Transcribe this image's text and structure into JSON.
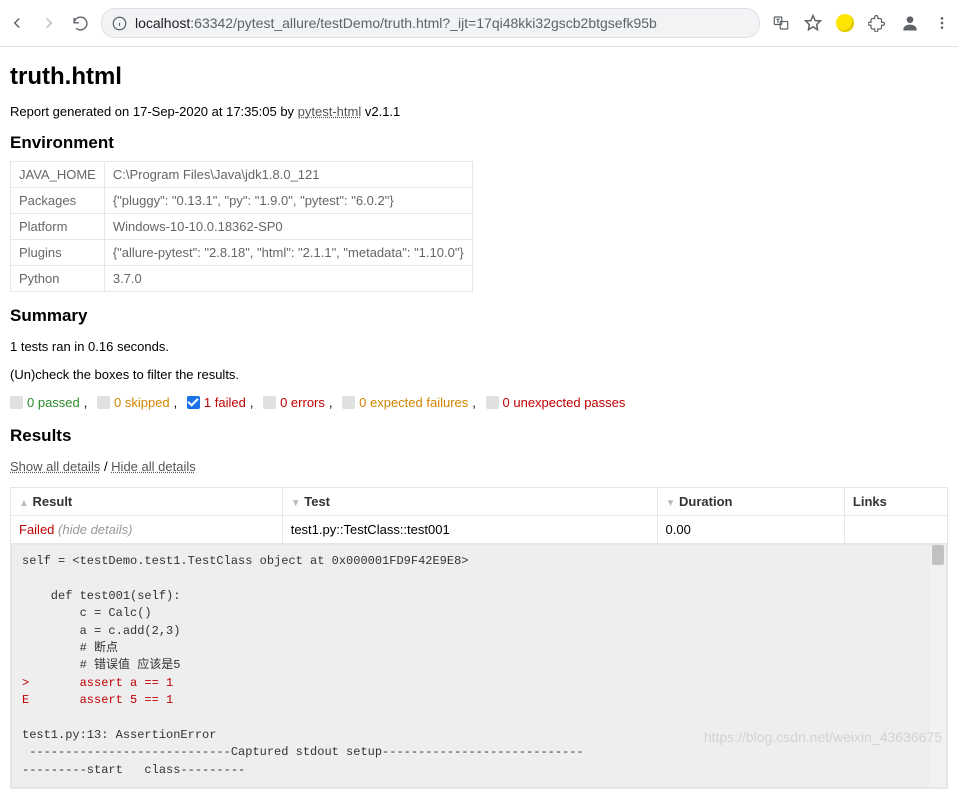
{
  "browser": {
    "host": "localhost",
    "rest": ":63342/pytest_allure/testDemo/truth.html?_ijt=17qi48kki32gscb2btgsefk95b"
  },
  "page": {
    "title": "truth.html",
    "report_prefix": "Report generated on 17-Sep-2020 at 17:35:05 by ",
    "report_link": "pytest-html",
    "report_suffix": " v2.1.1"
  },
  "env": {
    "heading": "Environment",
    "rows": [
      {
        "k": "JAVA_HOME",
        "v": "C:\\Program Files\\Java\\jdk1.8.0_121"
      },
      {
        "k": "Packages",
        "v": "{\"pluggy\": \"0.13.1\", \"py\": \"1.9.0\", \"pytest\": \"6.0.2\"}"
      },
      {
        "k": "Platform",
        "v": "Windows-10-10.0.18362-SP0"
      },
      {
        "k": "Plugins",
        "v": "{\"allure-pytest\": \"2.8.18\", \"html\": \"2.1.1\", \"metadata\": \"1.10.0\"}"
      },
      {
        "k": "Python",
        "v": "3.7.0"
      }
    ]
  },
  "summary": {
    "heading": "Summary",
    "line1": "1 tests ran in 0.16 seconds.",
    "line2": "(Un)check the boxes to filter the results.",
    "filters": {
      "passed": "0 passed",
      "skipped": "0 skipped",
      "failed": "1 failed",
      "errors": "0 errors",
      "xfail": "0 expected failures",
      "xpass": "0 unexpected passes"
    }
  },
  "results": {
    "heading": "Results",
    "show_all": "Show all details",
    "hide_all": "Hide all details",
    "headers": {
      "result": "Result",
      "test": "Test",
      "duration": "Duration",
      "links": "Links"
    },
    "row": {
      "status": "Failed",
      "hide": "(hide details)",
      "test": "test1.py::TestClass::test001",
      "duration": "0.00",
      "links": ""
    },
    "traceback": "self = <testDemo.test1.TestClass object at 0x000001FD9F42E9E8>\n\n    def test001(self):\n        c = Calc()\n        a = c.add(2,3)\n        # 断点\n        # 错误值 应该是5\n>       assert a == 1\nE       assert 5 == 1\n\ntest1.py:13: AssertionError\n ----------------------------Captured stdout setup----------------------------\n---------start   class---------"
  },
  "watermark": "https://blog.csdn.net/weixin_43636675"
}
